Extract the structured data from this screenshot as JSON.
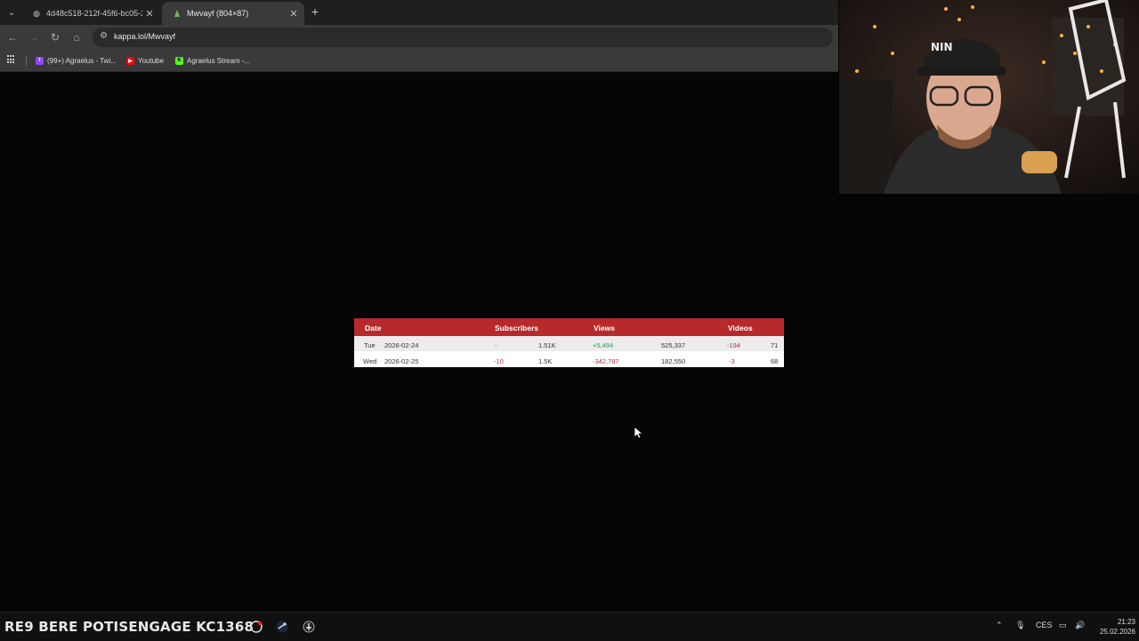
{
  "browser": {
    "tabs": [
      {
        "title": "4d48c518-212f-45f6-bc05-252c",
        "active": false
      },
      {
        "title": "Mwvayf (804×87)",
        "active": true
      }
    ],
    "new_tab_symbol": "+",
    "url": "kappa.lol/Mwvayf",
    "bookmarks": [
      {
        "label": "(99+) Agraelus - Twi...",
        "icon": "twitch-icon",
        "color": "#9146ff"
      },
      {
        "label": "Youtube",
        "icon": "youtube-icon",
        "color": "#ff0000"
      },
      {
        "label": "Agraelus Stream -...",
        "icon": "kick-icon",
        "color": "#53fc18"
      }
    ]
  },
  "table": {
    "headers": {
      "date": "Date",
      "subscribers": "Subscribers",
      "views": "Views",
      "videos": "Videos"
    },
    "rows": [
      {
        "day": "Tue",
        "date": "2026-02-24",
        "sub_change": "--",
        "subs": "1.51K",
        "view_change": "+5,494",
        "views": "525,337",
        "video_change": "-194",
        "videos": "71"
      },
      {
        "day": "Wed",
        "date": "2026-02-25",
        "sub_change": "-10",
        "subs": "1.5K",
        "view_change": "-342,787",
        "views": "182,550",
        "video_change": "-3",
        "videos": "68"
      }
    ],
    "colors": {
      "header": "#b8292b",
      "positive": "#2a9d48",
      "negative": "#c52a2f"
    }
  },
  "taskbar": {
    "ticker": "RE9 BERE POTISENGAGE KC1368",
    "tray": {
      "language": "CES"
    },
    "clock": {
      "time": "21:23",
      "date": "25.02.2026"
    }
  }
}
